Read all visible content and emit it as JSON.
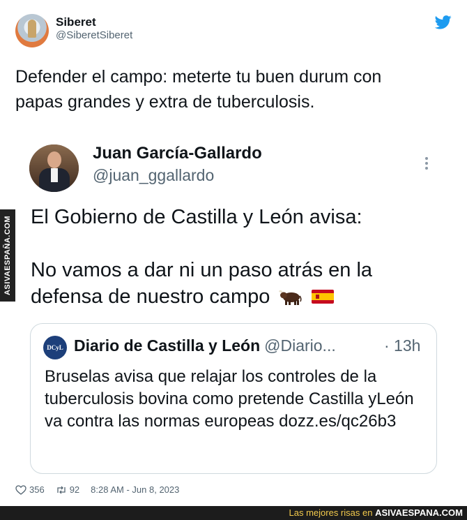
{
  "tweet": {
    "display_name": "Siberet",
    "handle": "@SiberetSiberet",
    "text": "Defender el campo: meterte tu buen durum con\npapas grandes y extra de tuberculosis.",
    "likes": "356",
    "retweets": "92",
    "timestamp": "8:28 AM - Jun 8, 2023"
  },
  "embedded": {
    "display_name": "Juan García-Gallardo",
    "handle": "@juan_ggallardo",
    "line1": "El Gobierno de Castilla y León avisa:",
    "line2": "No vamos a dar ni un paso atrás en la defensa de nuestro campo",
    "emojis": [
      "bull-emoji",
      "spain-flag-emoji"
    ],
    "quote": {
      "logo_text": "DCyL",
      "name": "Diario de Castilla y León",
      "handle": "@Diario...",
      "time": "· 13h",
      "text": "Bruselas avisa que relajar los controles de la tuberculosis bovina como pretende Castilla yLeón va contra las normas europeas dozz.es/qc26b3"
    }
  },
  "watermark": "ASIVAESPAÑA.COM",
  "footer": {
    "prefix": "Las mejores risas en ",
    "brand": "ASIVAESPANA.COM"
  },
  "colors": {
    "twitter_blue": "#1d9bf0",
    "text": "#0f1419",
    "muted": "#536471",
    "footer_bg": "#1c1c1c",
    "footer_text": "#f2c94c"
  },
  "icons": [
    "twitter-bird-icon",
    "more-vertical-icon",
    "heart-icon",
    "retweet-icon"
  ]
}
